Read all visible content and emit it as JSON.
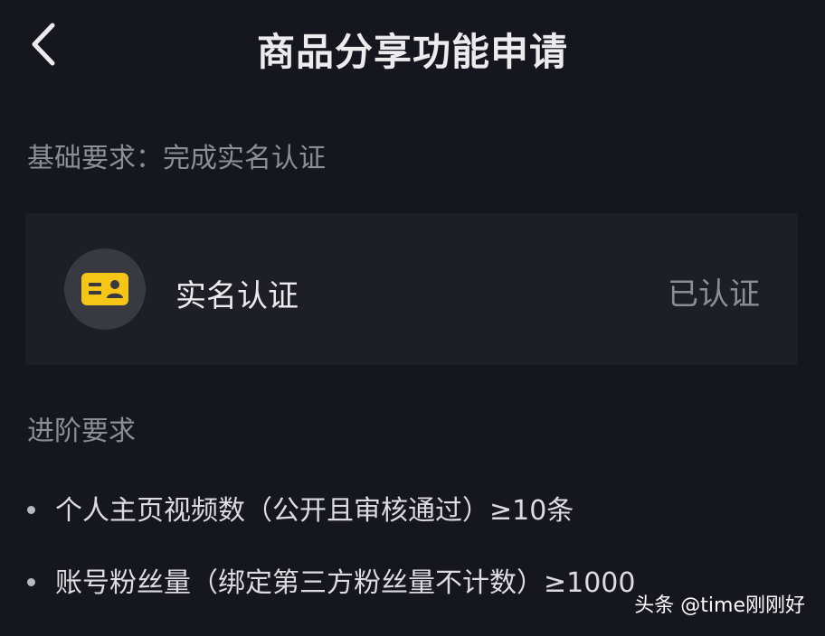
{
  "header": {
    "title": "商品分享功能申请",
    "back_icon": "chevron-left-icon"
  },
  "basic": {
    "label": "基础要求：完成实名认证",
    "card": {
      "icon": "id-card-icon",
      "icon_color": "#f5c518",
      "title": "实名认证",
      "status": "已认证"
    }
  },
  "advanced": {
    "label": "进阶要求",
    "items": [
      "个人主页视频数（公开且审核通过）≥10条",
      "账号粉丝量（绑定第三方粉丝量不计数）≥1000"
    ]
  },
  "watermark": "头条 @time刚刚好"
}
